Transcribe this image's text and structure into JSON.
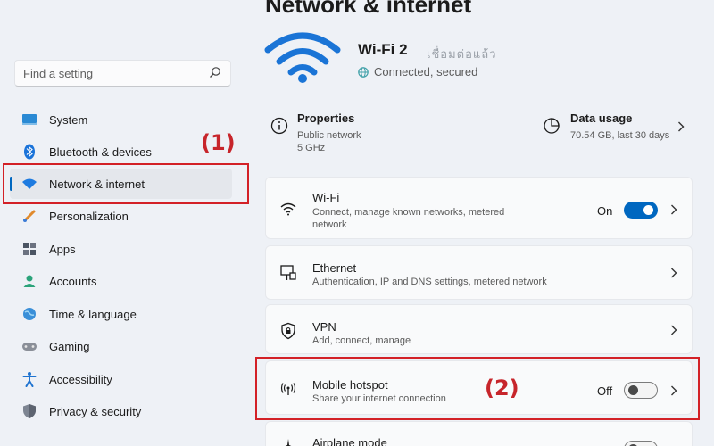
{
  "page": {
    "title": "Network & internet"
  },
  "search": {
    "placeholder": "Find a setting",
    "icon": "search-icon"
  },
  "nav": {
    "items": [
      {
        "label": "System",
        "icon": "system-icon"
      },
      {
        "label": "Bluetooth & devices",
        "icon": "bluetooth-icon"
      },
      {
        "label": "Network & internet",
        "icon": "wifi-icon",
        "active": true
      },
      {
        "label": "Personalization",
        "icon": "brush-icon"
      },
      {
        "label": "Apps",
        "icon": "apps-icon"
      },
      {
        "label": "Accounts",
        "icon": "person-icon"
      },
      {
        "label": "Time & language",
        "icon": "globe-icon"
      },
      {
        "label": "Gaming",
        "icon": "gamepad-icon"
      },
      {
        "label": "Accessibility",
        "icon": "accessibility-icon"
      },
      {
        "label": "Privacy & security",
        "icon": "shield-icon"
      }
    ]
  },
  "annotations": {
    "label1": "(1)",
    "label2": "(2)",
    "color": "#d32127"
  },
  "connection": {
    "name": "Wi-Fi 2",
    "name_obscured": "เชื่อมต่อแล้ว",
    "status": "Connected, secured"
  },
  "properties": {
    "title": "Properties",
    "network_type": "Public network",
    "band": "5 GHz"
  },
  "data_usage": {
    "title": "Data usage",
    "value": "70.54 GB, last 30 days"
  },
  "settings": {
    "wifi": {
      "title": "Wi-Fi",
      "subtitle": "Connect, manage known networks, metered network",
      "state": "On"
    },
    "ethernet": {
      "title": "Ethernet",
      "subtitle": "Authentication, IP and DNS settings, metered network"
    },
    "vpn": {
      "title": "VPN",
      "subtitle": "Add, connect, manage"
    },
    "hotspot": {
      "title": "Mobile hotspot",
      "subtitle": "Share your internet connection",
      "state": "Off"
    },
    "airplane": {
      "title": "Airplane mode"
    }
  },
  "colors": {
    "accent": "#0067c0",
    "highlight": "#d32127"
  }
}
